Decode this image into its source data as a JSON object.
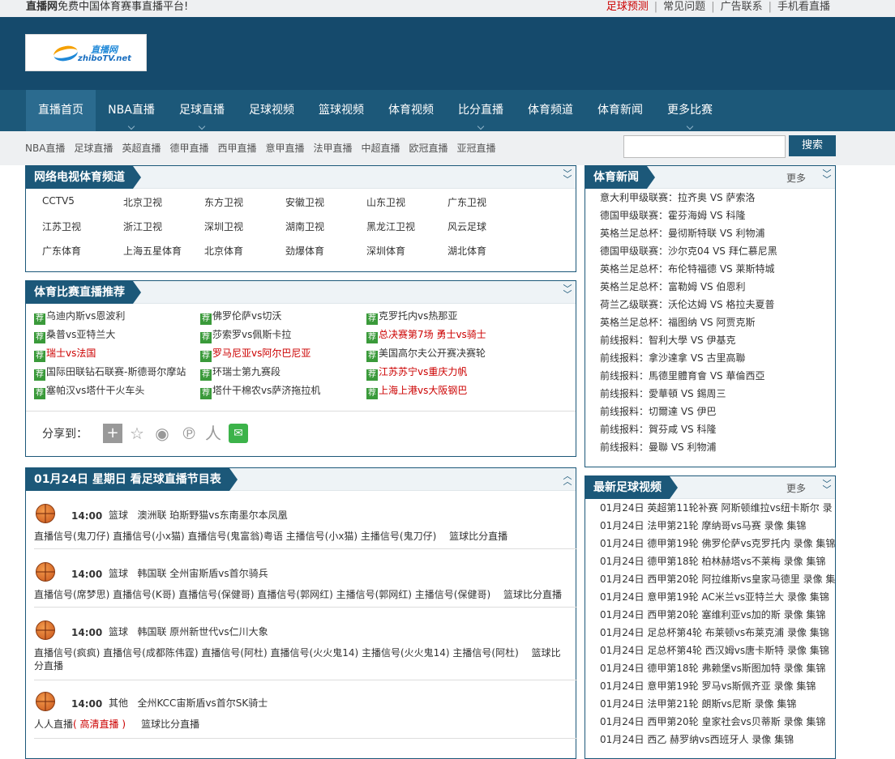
{
  "top": {
    "slogan_bold": "直播网",
    "slogan_rest": "免费中国体育赛事直播平台!",
    "links": [
      "足球预测",
      "常见问题",
      "广告联系",
      "手机看直播"
    ]
  },
  "logo": {
    "cn": "直播网",
    "en": "zhiboTV.net"
  },
  "nav": [
    "直播首页",
    "NBA直播",
    "足球直播",
    "足球视频",
    "篮球视频",
    "体育视频",
    "比分直播",
    "体育频道",
    "体育新闻",
    "更多比赛"
  ],
  "subnav": [
    "NBA直播",
    "足球直播",
    "英超直播",
    "德甲直播",
    "西甲直播",
    "意甲直播",
    "法甲直播",
    "中超直播",
    "欧冠直播",
    "亚冠直播"
  ],
  "search": {
    "button": "搜索",
    "placeholder": ""
  },
  "tv_panel": {
    "title": "网络电视体育频道",
    "channels": [
      "CCTV5",
      "北京卫视",
      "东方卫视",
      "安徽卫视",
      "山东卫视",
      "广东卫视",
      "江苏卫视",
      "浙江卫视",
      "深圳卫视",
      "湖南卫视",
      "黑龙江卫视",
      "风云足球",
      "广东体育",
      "上海五星体育",
      "北京体育",
      "劲爆体育",
      "深圳体育",
      "湖北体育"
    ]
  },
  "rec_panel": {
    "title": "体育比赛直播推荐",
    "tag": "荐",
    "items": [
      {
        "text": "乌迪内斯vs恩波利",
        "hot": false
      },
      {
        "text": "佛罗伦萨vs切沃",
        "hot": false
      },
      {
        "text": "克罗托内vs热那亚",
        "hot": false
      },
      {
        "text": "桑普vs亚特兰大",
        "hot": false
      },
      {
        "text": "莎索罗vs佩斯卡拉",
        "hot": false
      },
      {
        "text": "总决赛第7场 勇士vs骑士",
        "hot": true
      },
      {
        "text": "瑞士vs法国",
        "hot": true
      },
      {
        "text": "罗马尼亚vs阿尔巴尼亚",
        "hot": true
      },
      {
        "text": "美国高尔夫公开赛决赛轮",
        "hot": false
      },
      {
        "text": "国际田联钻石联赛-斯德哥尔摩站",
        "hot": false
      },
      {
        "text": "环瑞士第九赛段",
        "hot": false
      },
      {
        "text": "江苏苏宁vs重庆力帆",
        "hot": true
      },
      {
        "text": "塞帕汉vs塔什干火车头",
        "hot": false
      },
      {
        "text": "塔什干棉农vs萨济拖拉机",
        "hot": false
      },
      {
        "text": "上海上港vs大阪钢巴",
        "hot": true
      }
    ],
    "share_label": "分享到："
  },
  "schedule": {
    "title": "01月24日 星期日 看足球直播节目表",
    "games": [
      {
        "time": "14:00",
        "sport": "篮球",
        "info": "澳洲联 珀斯野猫vs东南墨尔本凤凰",
        "signals": "直播信号(鬼刀仔) 直播信号(小x猫) 直播信号(鬼富翁)粤语 主播信号(小x猫) 主播信号(鬼刀仔)　 篮球比分直播"
      },
      {
        "time": "14:00",
        "sport": "篮球",
        "info": "韩国联 全州宙斯盾vs首尔骑兵",
        "signals": "直播信号(席梦思) 直播信号(K哥) 直播信号(保健哥) 直播信号(郭网红) 主播信号(郭网红) 主播信号(保健哥)　 篮球比分直播"
      },
      {
        "time": "14:00",
        "sport": "篮球",
        "info": "韩国联 原州新世代vs仁川大象",
        "signals": "直播信号(疯疯) 直播信号(成都陈伟霆) 直播信号(阿杜) 直播信号(火火鬼14) 主播信号(火火鬼14) 主播信号(阿杜)　 篮球比分直播"
      },
      {
        "time": "14:00",
        "sport": "其他",
        "info": "全州KCC宙斯盾vs首尔SK骑士",
        "sig_prefix": "人人直播",
        "sig_hot": "( 高清直播 )",
        "sig_suffix": "篮球比分直播"
      }
    ]
  },
  "news_panel": {
    "title": "体育新闻",
    "more": "更多",
    "items": [
      "意大利甲级联赛：拉齐奥 VS 萨索洛",
      "德国甲级联赛：霍芬海姆 VS 科隆",
      "英格兰足总杯：曼彻斯特联 VS 利物浦",
      "德国甲级联赛：沙尔克04 VS 拜仁慕尼黑",
      "英格兰足总杯：布伦特福德 VS 莱斯特城",
      "英格兰足总杯：富勒姆 VS 伯恩利",
      "荷兰乙级联赛：沃伦达姆 VS 格拉夫夏普",
      "英格兰足总杯：福图纳 VS 阿贾克斯",
      "前线报料：智利大學 VS 伊基克",
      "前线报料：拿沙達拿 VS 古里高聯",
      "前线报料：馬德里體育會 VS 華倫西亞",
      "前线报料：愛華頓 VS 錫周三",
      "前线报料：切爾達 VS 伊巴",
      "前线报料：賀芬咸 VS 科隆",
      "前线报料：曼聯 VS 利物浦"
    ]
  },
  "video_panel": {
    "title": "最新足球视频",
    "more": "更多",
    "items": [
      "01月24日 英超第11轮补赛 阿斯顿维拉vs纽卡斯尔 录",
      "01月24日 法甲第21轮 摩纳哥vs马赛 录像 集锦",
      "01月24日 德甲第19轮 佛罗伦萨vs克罗托内 录像 集锦",
      "01月24日 德甲第18轮 柏林赫塔vs不莱梅 录像 集锦",
      "01月24日 西甲第20轮 阿拉维斯vs皇家马德里 录像 集",
      "01月24日 意甲第19轮 AC米兰vs亚特兰大 录像 集锦",
      "01月24日 西甲第20轮 塞维利亚vs加的斯 录像 集锦",
      "01月24日 足总杯第4轮 布莱顿vs布莱克浦 录像 集锦",
      "01月24日 足总杯第4轮 西汉姆vs唐卡斯特 录像 集锦",
      "01月24日 德甲第18轮 弗赖堡vs斯图加特 录像 集锦",
      "01月24日 意甲第19轮 罗马vs斯佩齐亚 录像 集锦",
      "01月24日 法甲第21轮 朗斯vs尼斯 录像 集锦",
      "01月24日 西甲第20轮 皇家社会vs贝蒂斯 录像 集锦",
      "01月24日 西乙 赫罗纳vs西班牙人 录像 集锦"
    ]
  }
}
